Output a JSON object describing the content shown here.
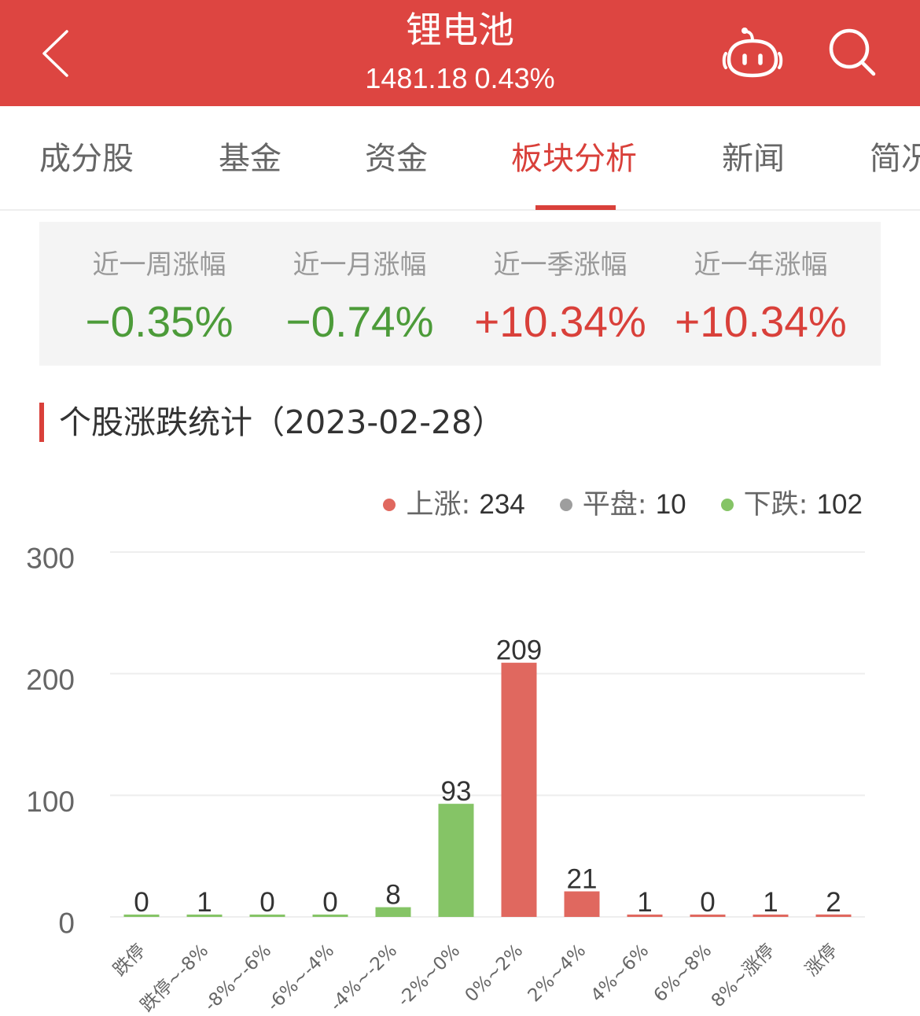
{
  "header": {
    "title": "锂电池",
    "price": "1481.18",
    "change": "0.43%",
    "icons": {
      "back": "chevron-left-icon",
      "robot": "robot-icon",
      "search": "search-icon"
    }
  },
  "tabs": [
    {
      "label": "成分股",
      "active": false
    },
    {
      "label": "基金",
      "active": false
    },
    {
      "label": "资金",
      "active": false
    },
    {
      "label": "板块分析",
      "active": true
    },
    {
      "label": "新闻",
      "active": false
    },
    {
      "label": "简况",
      "active": false
    }
  ],
  "performance": [
    {
      "label": "近一周涨幅",
      "value": "−0.35%",
      "trend": "down"
    },
    {
      "label": "近一月涨幅",
      "value": "−0.74%",
      "trend": "down"
    },
    {
      "label": "近一季涨幅",
      "value": "+10.34%",
      "trend": "up"
    },
    {
      "label": "近一年涨幅",
      "value": "+10.34%",
      "trend": "up"
    }
  ],
  "section": {
    "title": "个股涨跌统计（2023-02-28）"
  },
  "colors": {
    "header_bg": "#DD4541",
    "accent": "#D9403A",
    "up_text": "#D9403A",
    "down_text": "#4C9B39",
    "up_bar": "#E0685F",
    "down_bar": "#85C466",
    "flat": "#9E9E9E"
  },
  "chart_data": {
    "type": "bar",
    "title": "个股涨跌统计（2023-02-28）",
    "xlabel": "",
    "ylabel": "",
    "categories": [
      "跌停",
      "跌停~-8%",
      "-8%~-6%",
      "-6%~-4%",
      "-4%~-2%",
      "-2%~0%",
      "0%~2%",
      "2%~4%",
      "4%~6%",
      "6%~8%",
      "8%~涨停",
      "涨停"
    ],
    "values": [
      0,
      1,
      0,
      0,
      8,
      93,
      209,
      21,
      1,
      0,
      1,
      2
    ],
    "bar_groups": [
      "down",
      "down",
      "down",
      "down",
      "down",
      "down",
      "up",
      "up",
      "up",
      "up",
      "up",
      "up"
    ],
    "ylim": [
      0,
      300
    ],
    "yticks": [
      0,
      100,
      200,
      300
    ],
    "grid": true,
    "show_data_labels": true,
    "xtick_rotation": -45,
    "legend": {
      "position": "top-right",
      "separator": ": ",
      "entries": [
        {
          "label": "上涨",
          "value": "234",
          "color": "#E0685F"
        },
        {
          "label": "平盘",
          "value": "10",
          "color": "#9E9E9E"
        },
        {
          "label": "下跌",
          "value": "102",
          "color": "#85C466"
        }
      ]
    }
  }
}
